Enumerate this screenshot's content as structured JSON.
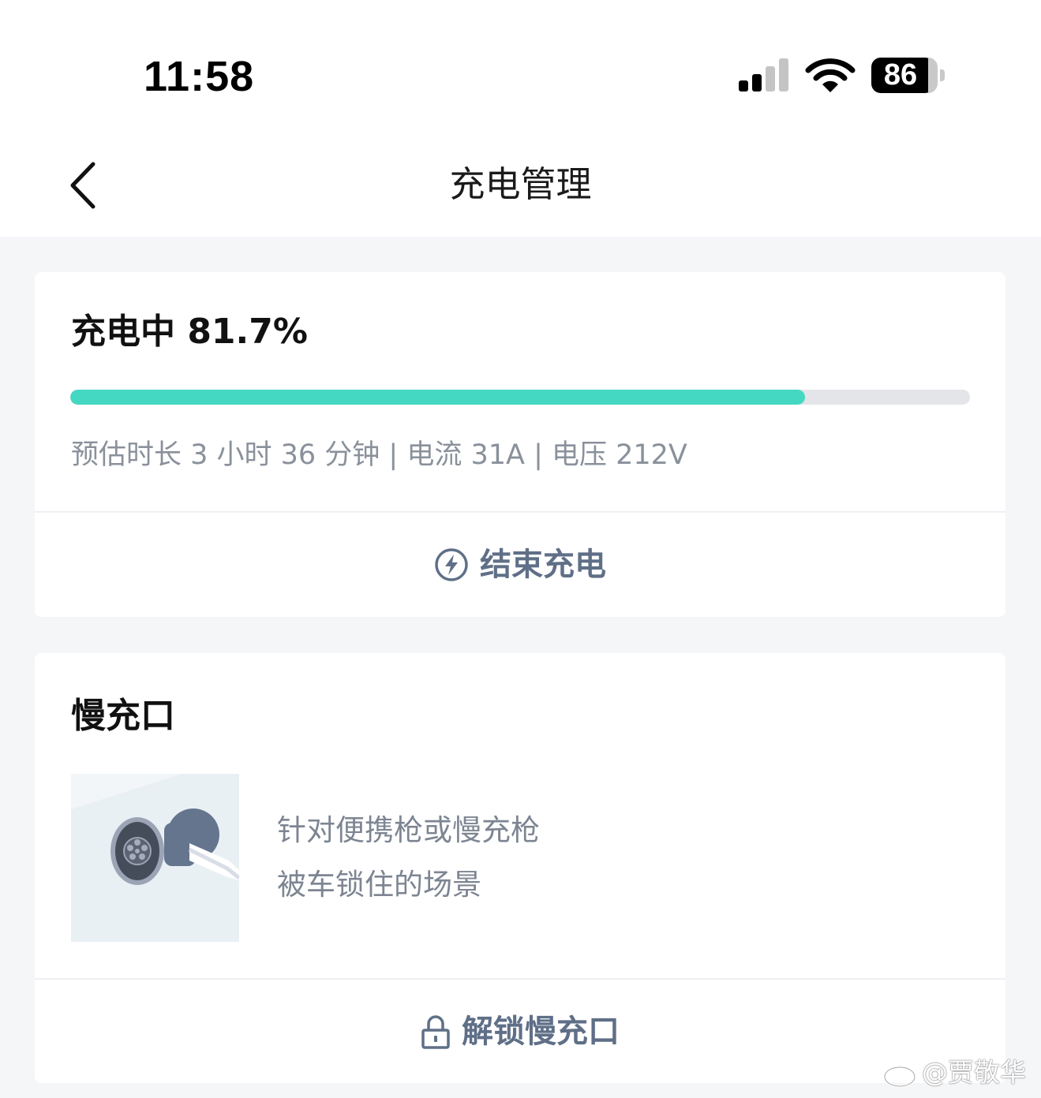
{
  "status_bar": {
    "time": "11:58",
    "battery_level": "86",
    "signal_bars_active": 2,
    "signal_bars_total": 4
  },
  "nav": {
    "title": "充电管理",
    "back_icon": "chevron-left-icon"
  },
  "charging": {
    "status_text": "充电中 81.7%",
    "progress_percent": 81.7,
    "info_text": "预估时长 3 小时 36 分钟 | 电流 31A | 电压 212V",
    "end_button_label": "结束充电",
    "end_button_icon": "lightning-circle-icon"
  },
  "slow_port": {
    "title": "慢充口",
    "desc_line1": "针对便携枪或慢充枪",
    "desc_line2": "被车锁住的场景",
    "unlock_button_label": "解锁慢充口",
    "unlock_button_icon": "lock-icon"
  },
  "watermark": {
    "text": "@贾敬华"
  },
  "colors": {
    "progress_fill": "#44d8c2",
    "progress_track": "#e4e5e8",
    "action_text": "#5f6f87",
    "page_background": "#f5f6f8"
  }
}
